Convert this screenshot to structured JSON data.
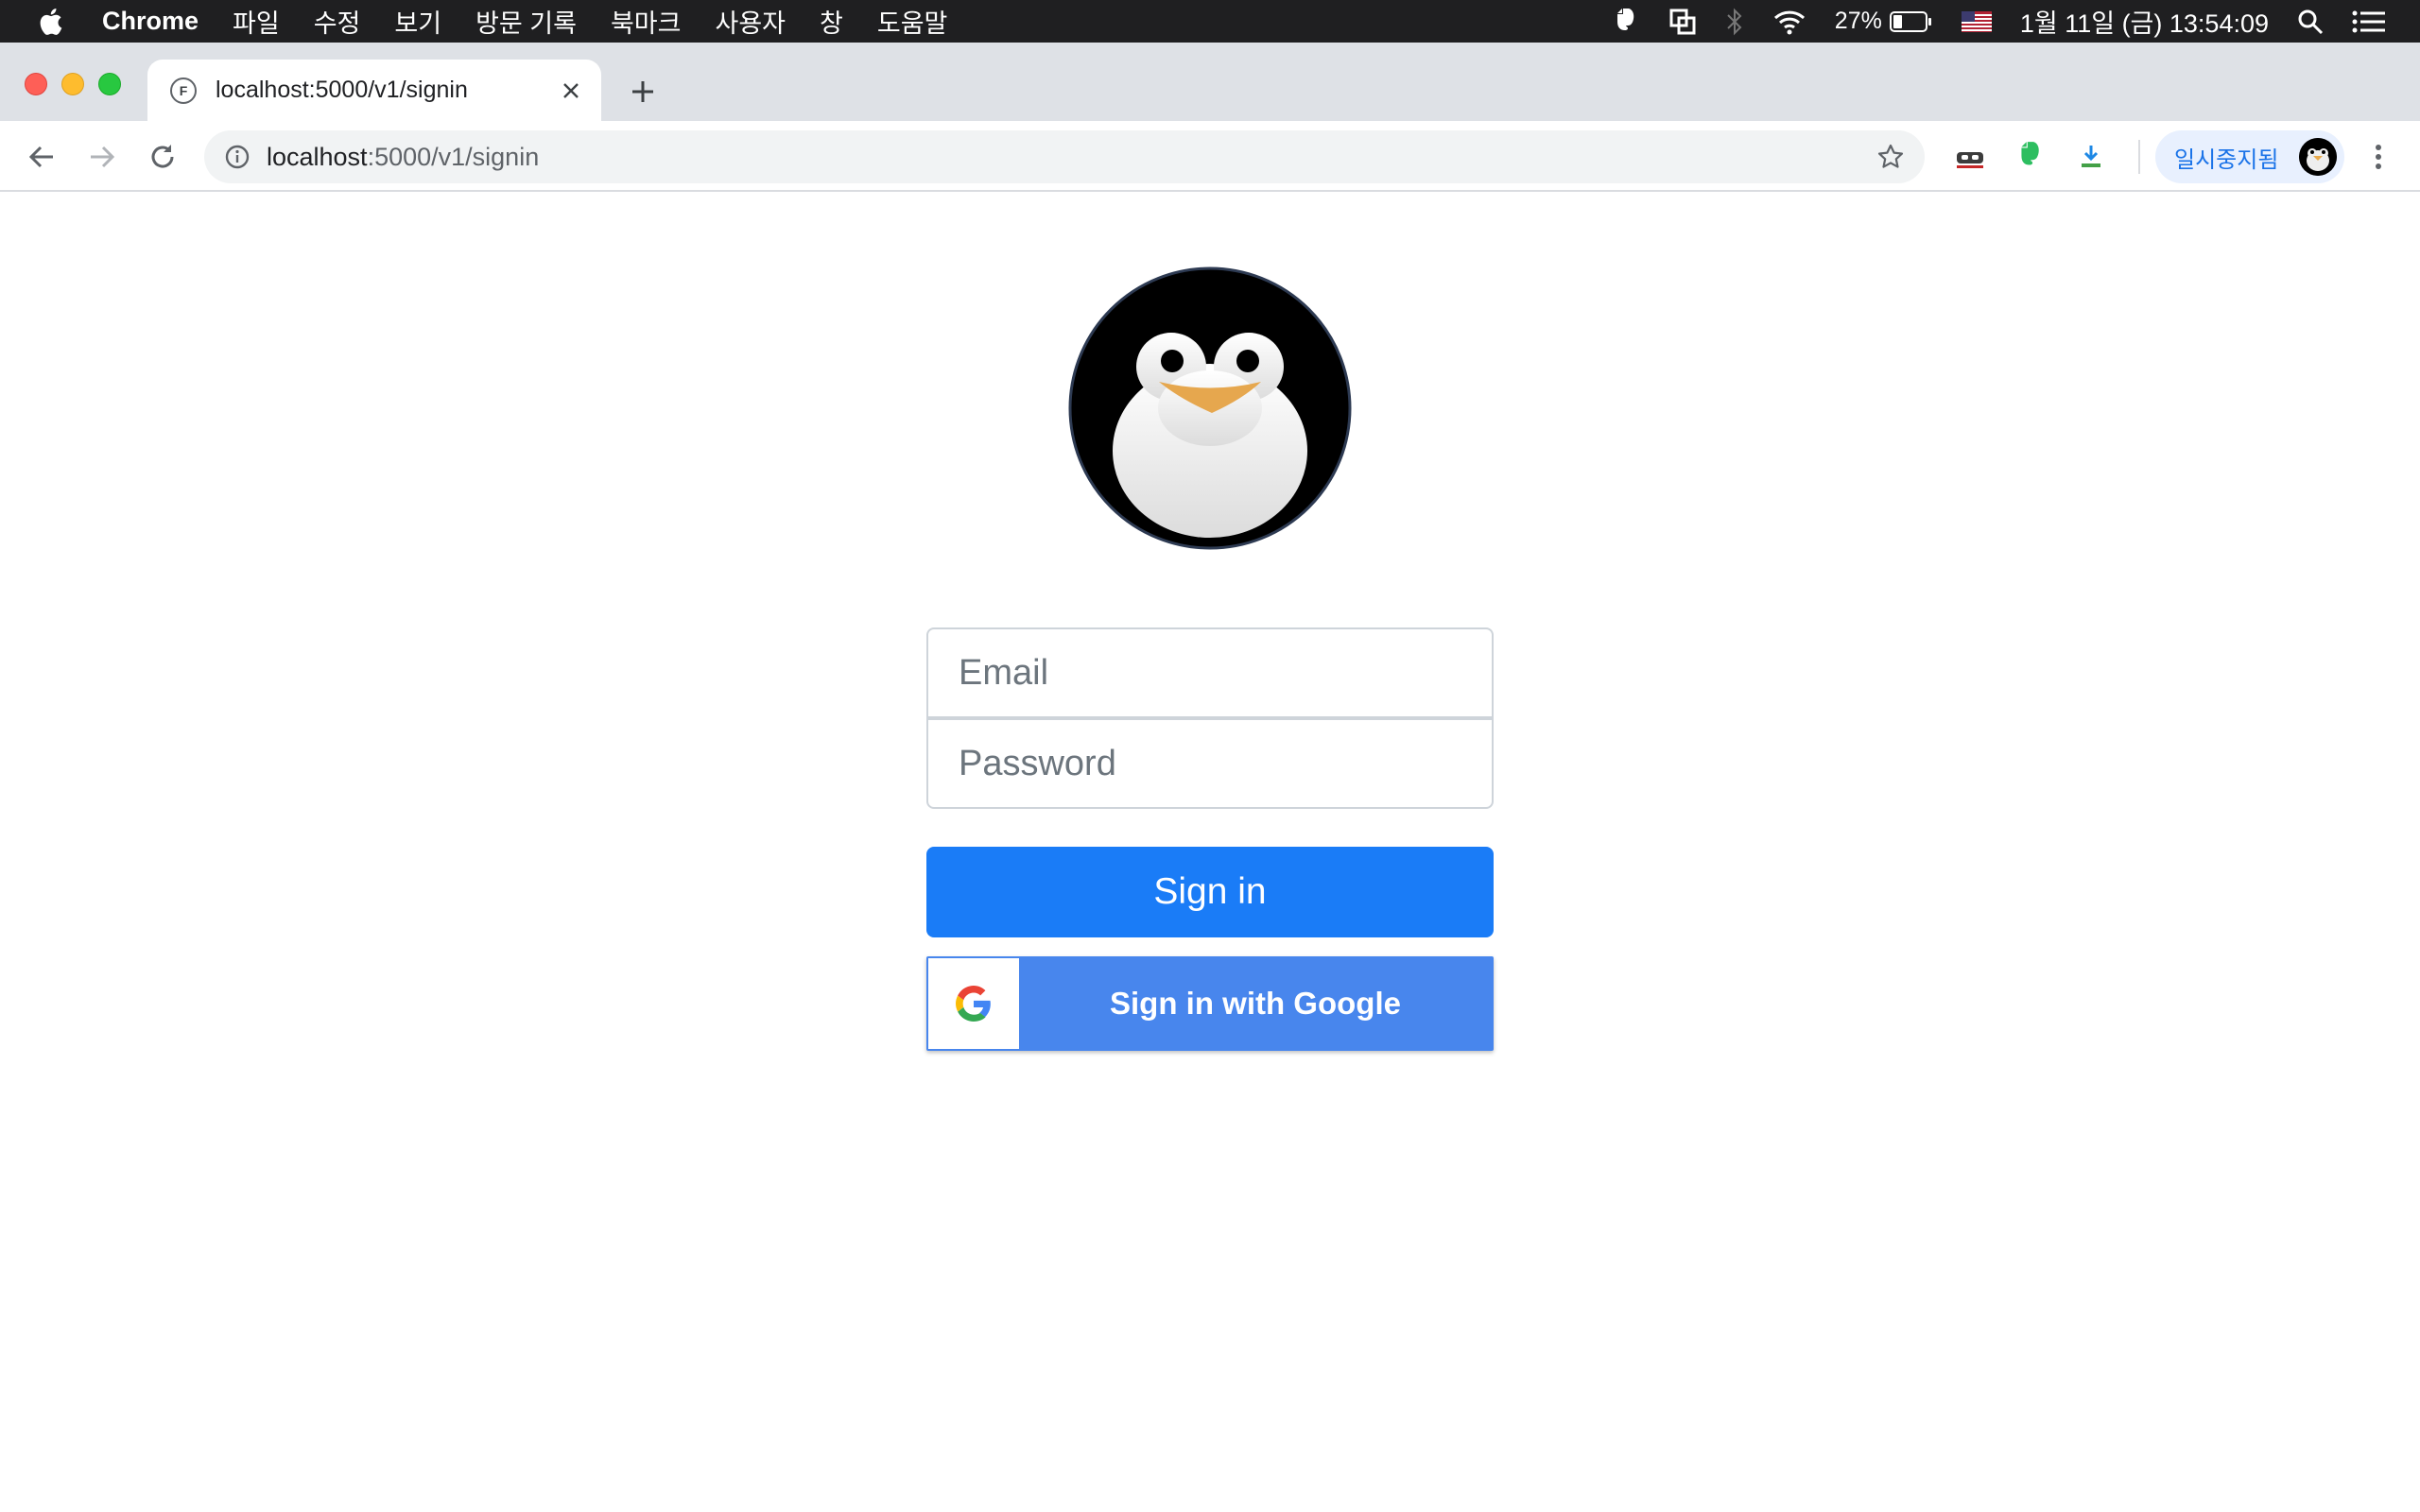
{
  "menubar": {
    "app_name": "Chrome",
    "menus": [
      "파일",
      "수정",
      "보기",
      "방문 기록",
      "북마크",
      "사용자",
      "창",
      "도움말"
    ],
    "battery_percent": "27%",
    "datetime": "1월 11일 (금)  13:54:09",
    "status_icons": [
      "evernote-icon",
      "screen-share-icon",
      "bluetooth-icon",
      "wifi-icon",
      "battery-icon",
      "us-flag-icon",
      "spotlight-icon",
      "notification-center-icon"
    ]
  },
  "browser": {
    "tab": {
      "title": "localhost:5000/v1/signin",
      "favicon_letter": "F"
    },
    "omnibox": {
      "host": "localhost",
      "path": ":5000/v1/signin"
    },
    "extensions": [
      "incognito-mask-icon",
      "evernote-icon",
      "download-extension-icon"
    ],
    "profile": {
      "label": "일시중지됨"
    }
  },
  "signin": {
    "email_placeholder": "Email",
    "password_placeholder": "Password",
    "signin_label": "Sign in",
    "google_label": "Sign in with Google"
  },
  "colors": {
    "primary": "#1a7cf7",
    "google_blue": "#4886ed",
    "menubar": "#1f1f21",
    "tabstrip": "#dee1e6"
  }
}
